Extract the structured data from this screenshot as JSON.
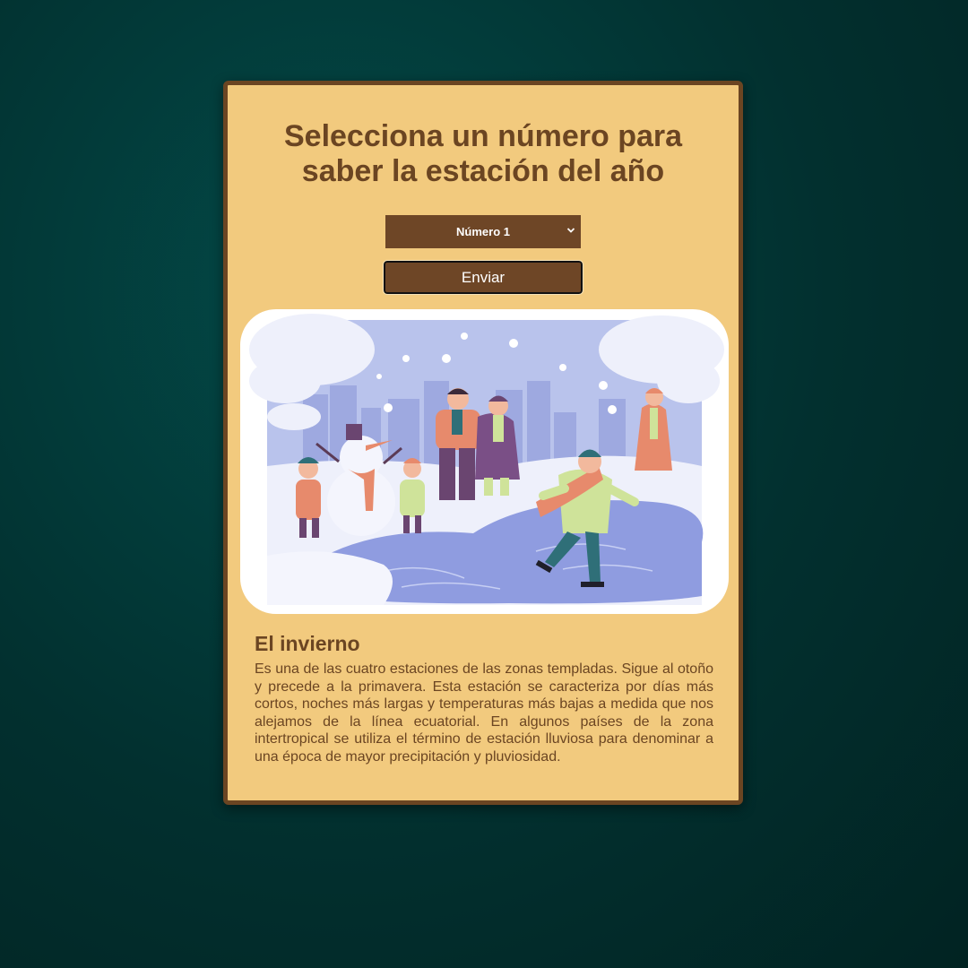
{
  "page": {
    "title": "Selecciona un número para saber la estación del año"
  },
  "form": {
    "select_value": "Número 1",
    "submit_label": "Enviar"
  },
  "season": {
    "name": "El invierno",
    "description": "Es una de las cuatro estaciones de las zonas templadas. Sigue al otoño y precede a la primavera. Esta estación se caracteriza por días más cortos, noches más largas y temperaturas más bajas a medida que nos alejamos de la línea ecuatorial. En algunos países de la zona intertropical se utiliza el término de estación lluviosa para denominar a una época de mayor precipitación y pluviosidad."
  },
  "icons": {
    "select_arrow": "chevron-down-icon"
  },
  "colors": {
    "background": "#023d3c",
    "card": "#f2ca7e",
    "accent_brown": "#6b4522",
    "button": "#6e4626"
  }
}
